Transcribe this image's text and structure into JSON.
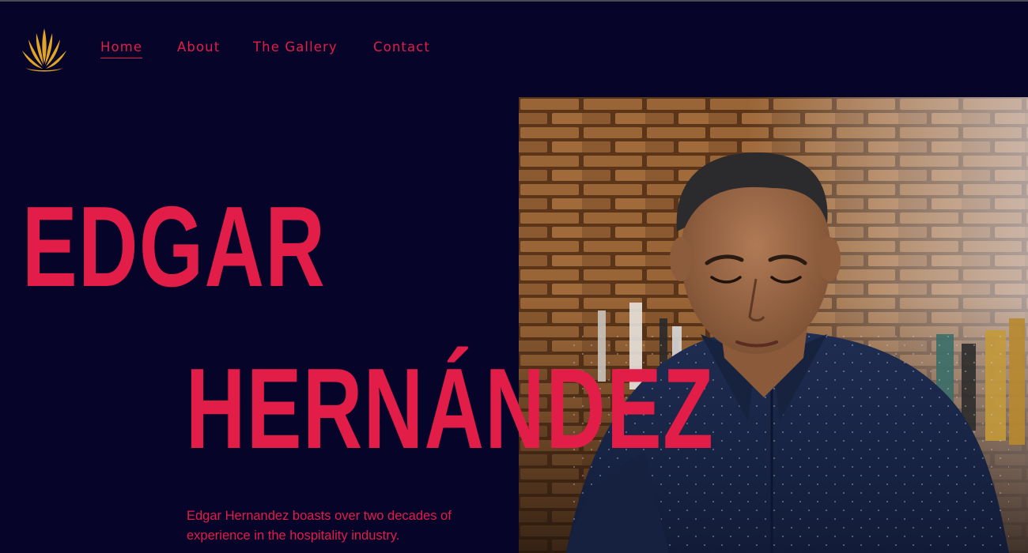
{
  "nav": {
    "items": [
      {
        "label": "Home",
        "active": true
      },
      {
        "label": "About",
        "active": false
      },
      {
        "label": "The Gallery",
        "active": false
      },
      {
        "label": "Contact",
        "active": false
      }
    ]
  },
  "logo": {
    "icon": "agave-icon",
    "color": "#e0a526"
  },
  "hero": {
    "first_name": "EDGAR",
    "last_name": "HERNÁNDEZ",
    "bio": "Edgar Hernandez boasts over two decades of experience in the hospitality industry.",
    "photo_icon": "portrait-photo"
  },
  "colors": {
    "background": "#07042a",
    "accent": "#e11d48",
    "logo": "#e0a526"
  }
}
